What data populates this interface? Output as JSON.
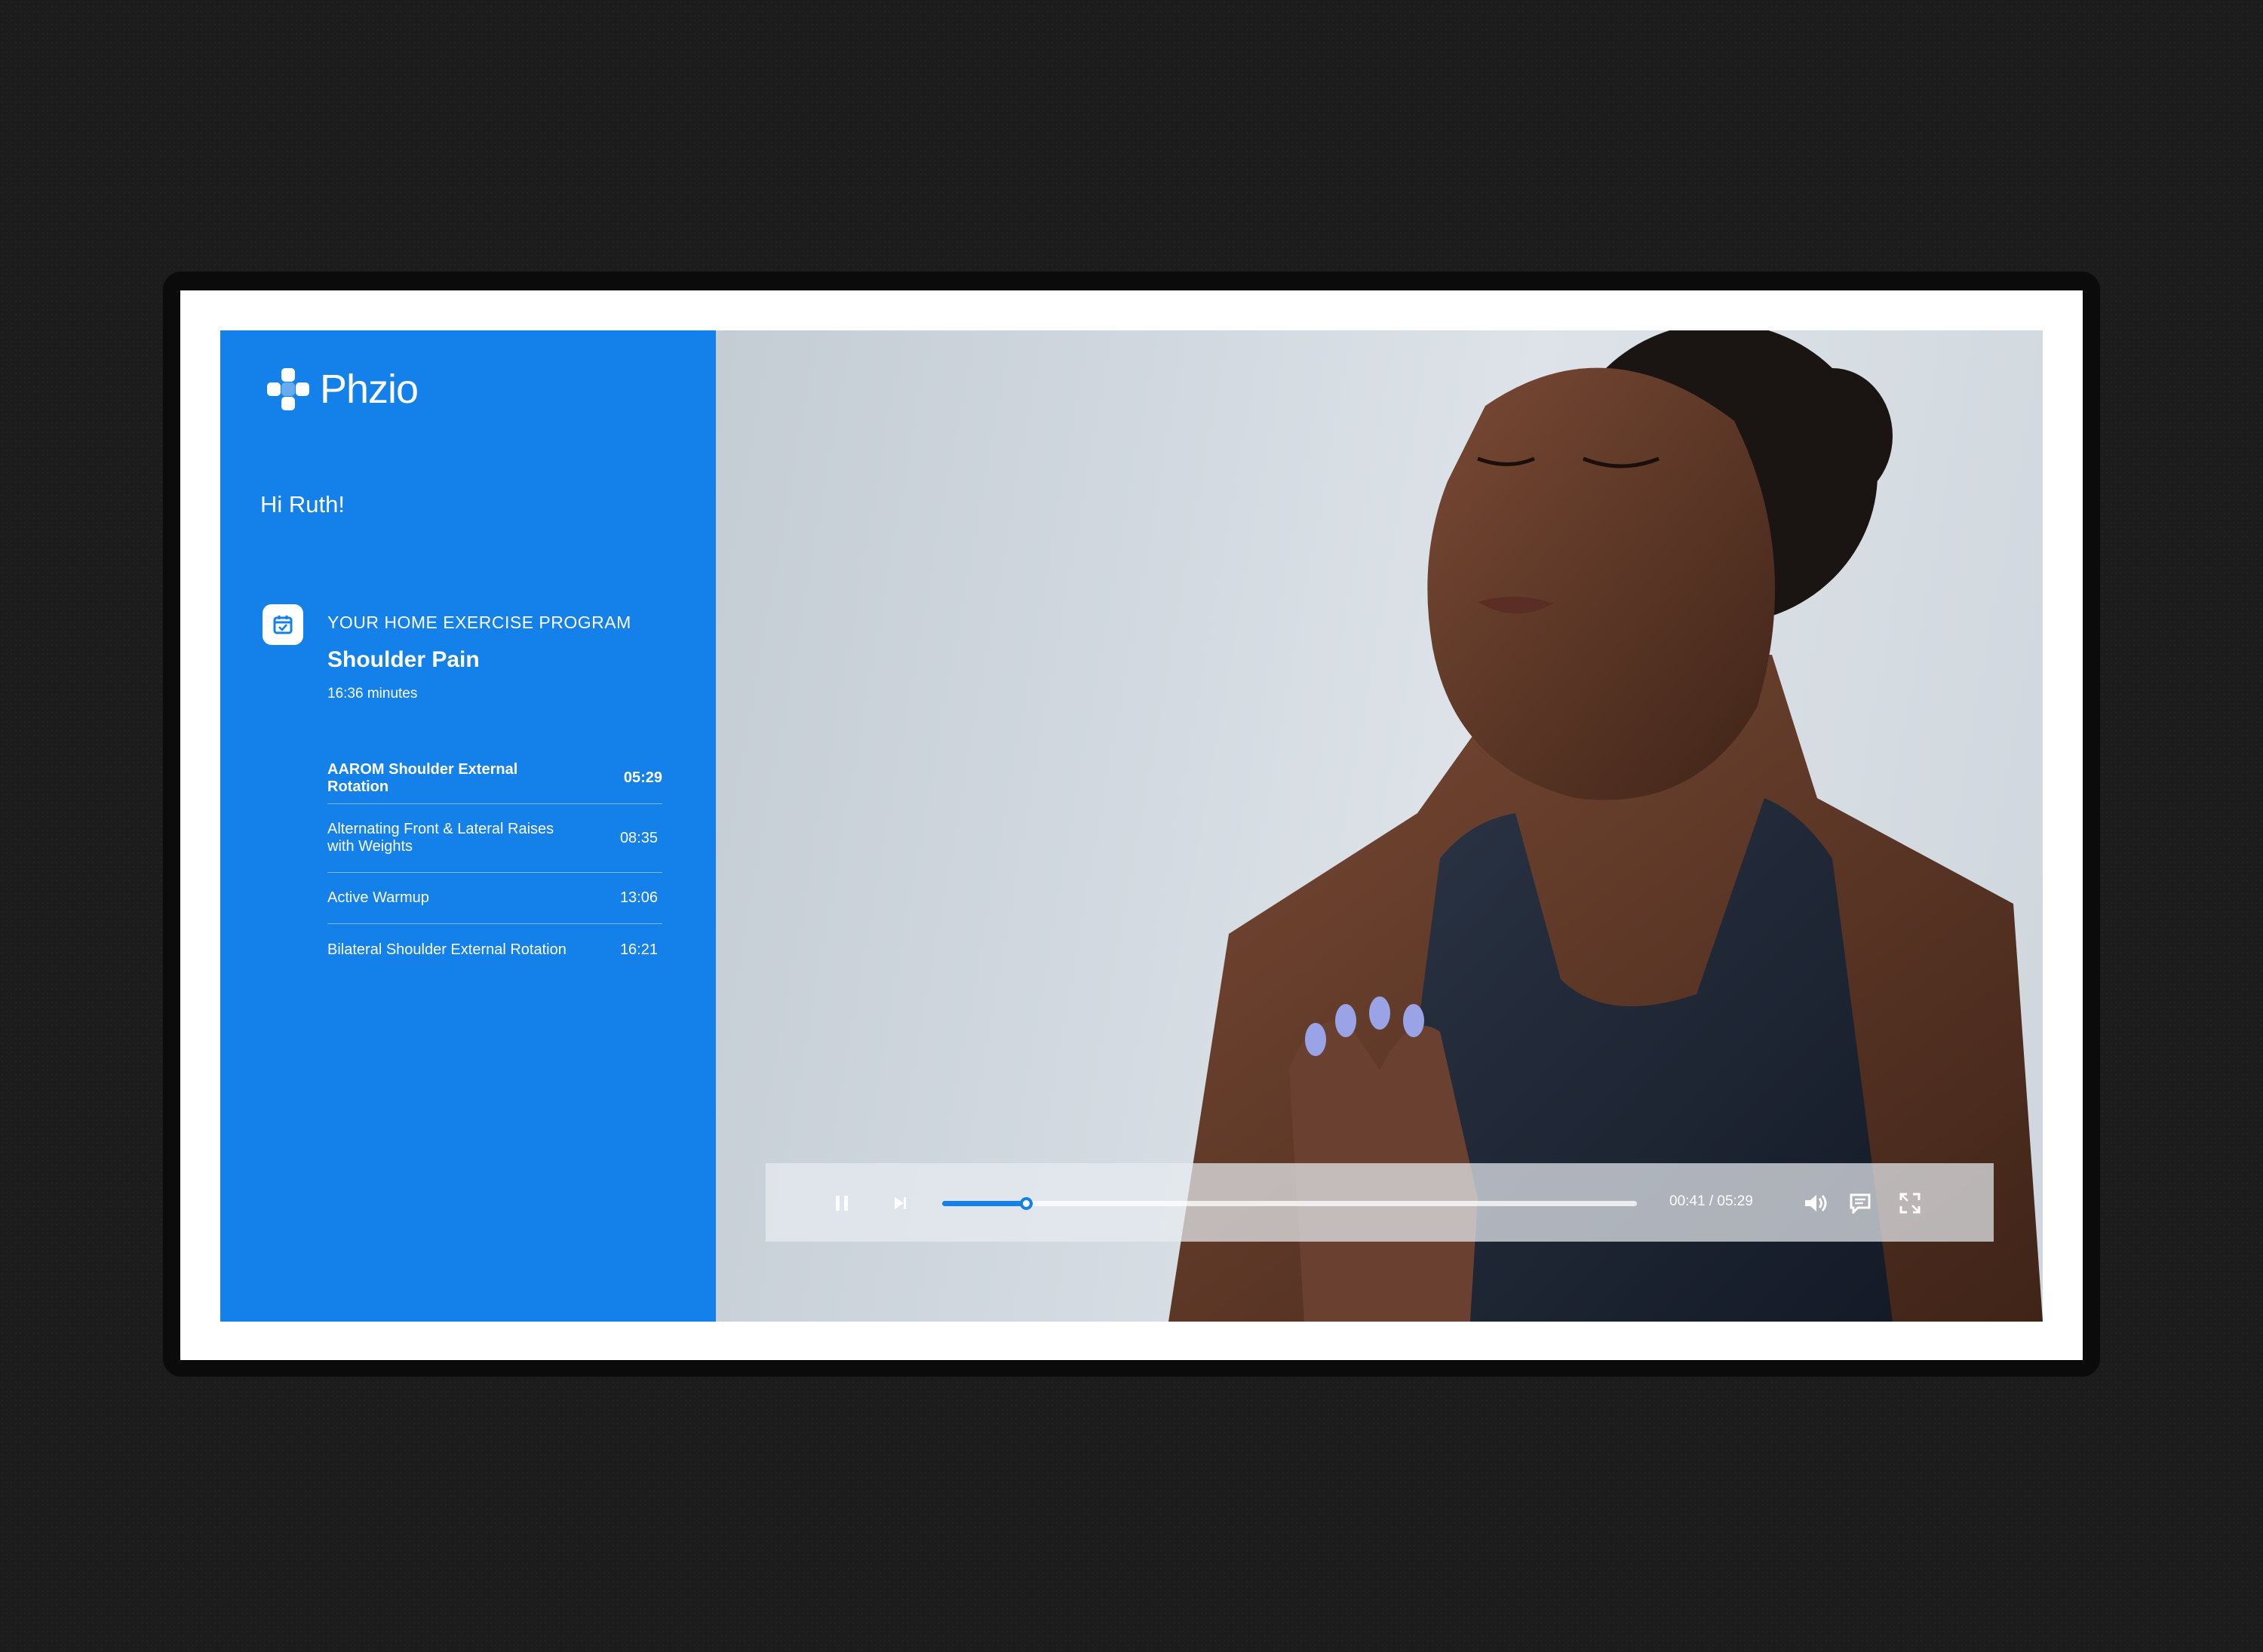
{
  "brand": {
    "name": "Phzio",
    "logo_icon": "plus-cross-logo-icon"
  },
  "user": {
    "greeting": "Hi Ruth!"
  },
  "program": {
    "label": "YOUR HOME EXERCISE PROGRAM",
    "title": "Shoulder Pain",
    "duration": "16:36 minutes",
    "icon": "calendar-check-icon"
  },
  "exercises": [
    {
      "name": "AAROM Shoulder External Rotation",
      "time": "05:29",
      "active": true
    },
    {
      "name": "Alternating Front & Lateral Raises with Weights",
      "time": "08:35",
      "active": false
    },
    {
      "name": "Active Warmup",
      "time": "13:06",
      "active": false
    },
    {
      "name": "Bilateral Shoulder External Rotation",
      "time": "16:21",
      "active": false
    }
  ],
  "player": {
    "current_time": "00:41",
    "total_time": "05:29",
    "time_display": "00:41 / 05:29",
    "progress": 0.12,
    "icons": [
      "pause-icon",
      "skip-next-icon",
      "volume-icon",
      "captions-icon",
      "fullscreen-icon"
    ]
  },
  "colors": {
    "brand_blue": "#1480ea",
    "background": "#1c1c1c",
    "screen": "#ffffff"
  }
}
